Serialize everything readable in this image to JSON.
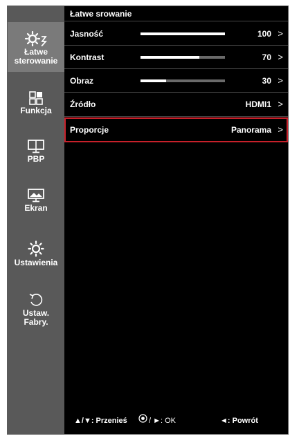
{
  "sidebar": {
    "items": [
      {
        "label": "Łatwe sterowanie",
        "icon": "easy-control-icon",
        "active": true
      },
      {
        "label": "Funkcja",
        "icon": "function-icon"
      },
      {
        "label": "PBP",
        "icon": "pbp-icon"
      },
      {
        "label": "Ekran",
        "icon": "screen-icon"
      },
      {
        "label": "Ustawienia",
        "icon": "settings-icon"
      },
      {
        "label": "Ustaw. Fabry.",
        "icon": "factory-reset-icon"
      }
    ]
  },
  "main": {
    "title": "Łatwe srowanie",
    "rows": [
      {
        "label": "Jasność",
        "value": "100",
        "level": 1.0
      },
      {
        "label": "Kontrast",
        "value": "70",
        "level": 0.7
      },
      {
        "label": "Obraz",
        "value": "30",
        "level": 0.3
      },
      {
        "label": "Źródło",
        "value": "HDMI1"
      },
      {
        "label": "Proporcje",
        "value": "Panorama",
        "selected": true
      }
    ],
    "chevron": ">"
  },
  "footer": {
    "move": "▲/▼: Przenieś",
    "ok": "/ ►: OK",
    "back": "◄: Powrót"
  },
  "colors": {
    "sidebar_bg": "#595959",
    "active_bg": "#7a7a7a",
    "highlight": "#c8202a"
  }
}
